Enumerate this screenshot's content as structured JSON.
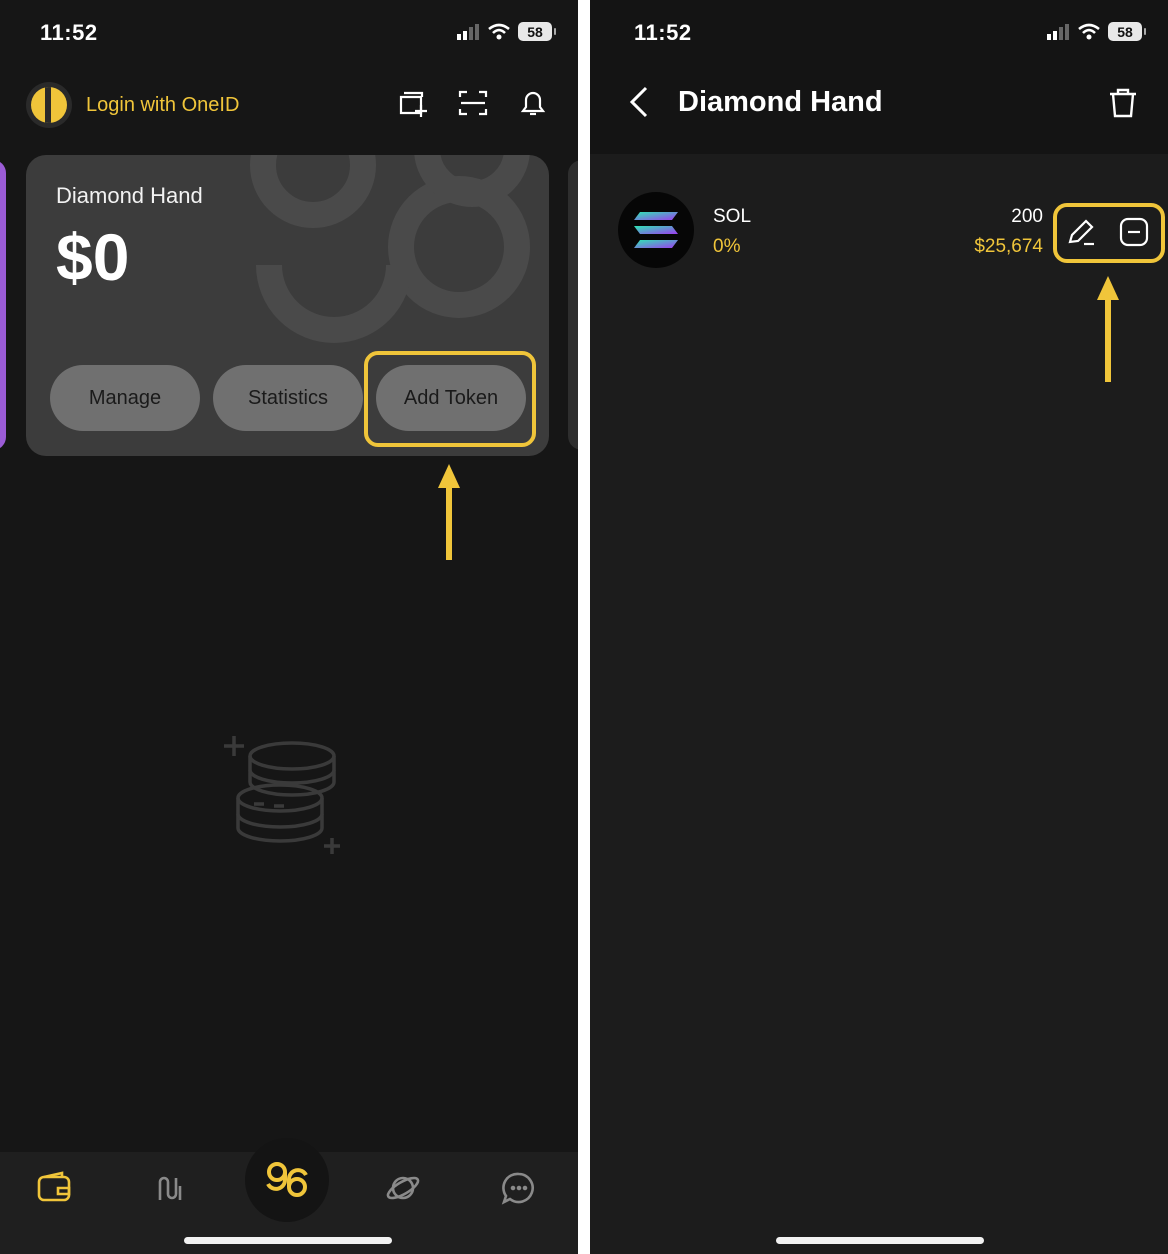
{
  "left": {
    "status": {
      "time": "11:52",
      "battery": "58"
    },
    "header": {
      "login_label": "Login with OneID"
    },
    "card": {
      "title": "Diamond Hand",
      "balance": "$0",
      "buttons": {
        "manage": "Manage",
        "statistics": "Statistics",
        "add_token": "Add Token"
      }
    },
    "tabs": [
      {
        "name": "wallet",
        "active": true
      },
      {
        "name": "swap",
        "active": false
      },
      {
        "name": "home",
        "active": false
      },
      {
        "name": "explore",
        "active": false
      },
      {
        "name": "chat",
        "active": false
      }
    ]
  },
  "right": {
    "status": {
      "time": "11:52",
      "battery": "58"
    },
    "nav": {
      "title": "Diamond Hand"
    },
    "tokens": [
      {
        "symbol": "SOL",
        "change": "0%",
        "amount": "200",
        "value": "$25,674"
      }
    ]
  },
  "colors": {
    "accent": "#f0c53a",
    "background": "#161616",
    "card": "#3c3c3c",
    "pill": "#707070"
  }
}
